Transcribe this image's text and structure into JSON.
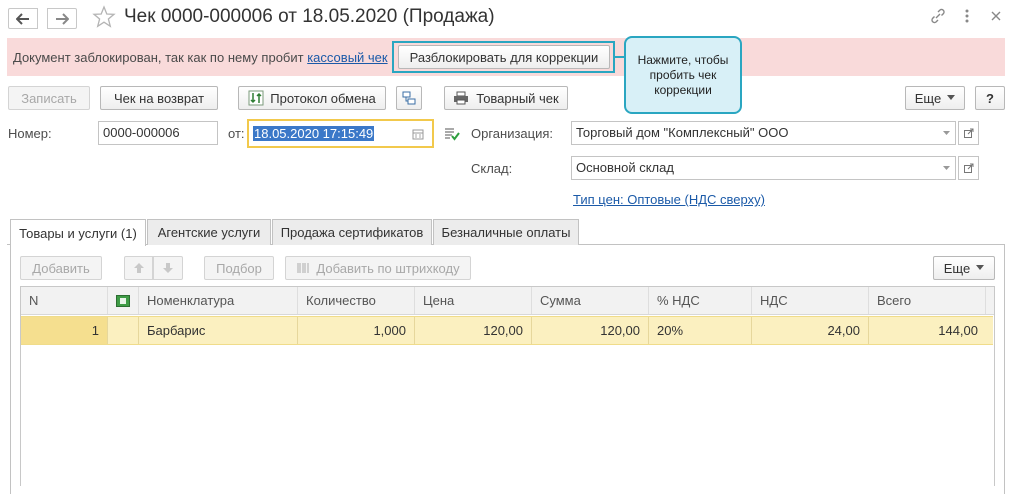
{
  "window": {
    "title": "Чек 0000-000006 от 18.05.2020 (Продажа)",
    "back_icon": "arrow-left",
    "forward_icon": "arrow-right",
    "star_icon": "star",
    "link_icon": "link",
    "menu_icon": "more-vertical",
    "close_icon": "close"
  },
  "banner": {
    "text": "Документ заблокирован, так как по нему пробит ",
    "link": "кассовый чек",
    "unlock_button": "Разблокировать для коррекции",
    "bg": "#f9dada"
  },
  "callout": {
    "text": "Нажмите, чтобы пробить чек коррекции",
    "bg": "#d8f0f7",
    "border": "#2aa6c1"
  },
  "toolbar": {
    "save": "Записать",
    "return_check": "Чек на возврат",
    "exchange_log": "Протокол обмена",
    "goods_check": "Товарный чек",
    "more": "Еще",
    "help": "?"
  },
  "form": {
    "number_label": "Номер:",
    "number_value": "0000-000006",
    "date_label": "от:",
    "date_value": "18.05.2020 17:15:49",
    "org_label": "Организация:",
    "org_value": "Торговый дом \"Комплексный\" ООО",
    "warehouse_label": "Склад:",
    "warehouse_value": "Основной склад",
    "price_type_link": "Тип цен: Оптовые (НДС сверху)"
  },
  "tabs": [
    {
      "label": "Товары и услуги (1)",
      "active": true
    },
    {
      "label": "Агентские услуги",
      "active": false
    },
    {
      "label": "Продажа сертификатов",
      "active": false
    },
    {
      "label": "Безналичные оплаты",
      "active": false
    }
  ],
  "table_toolbar": {
    "add": "Добавить",
    "pick": "Подбор",
    "add_barcode": "Добавить по штрихкоду",
    "more": "Еще"
  },
  "table": {
    "columns": [
      "N",
      "",
      "Номенклатура",
      "Количество",
      "Цена",
      "Сумма",
      "% НДС",
      "НДС",
      "Всего"
    ],
    "rows": [
      [
        "1",
        "",
        "Барбарис",
        "1,000",
        "120,00",
        "120,00",
        "20%",
        "24,00",
        "144,00"
      ]
    ],
    "selected_row_bg": "#fbf0c0"
  }
}
